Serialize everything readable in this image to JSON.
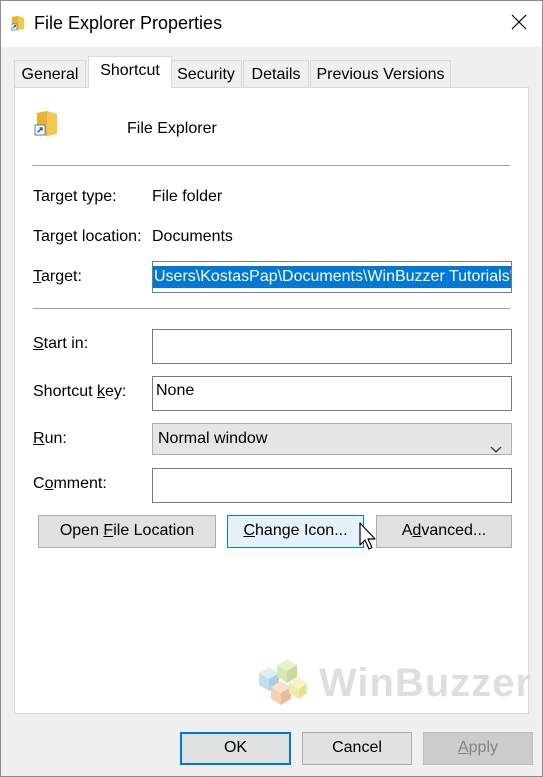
{
  "window": {
    "title": "File Explorer Properties"
  },
  "tabs": [
    "General",
    "Shortcut",
    "Security",
    "Details",
    "Previous Versions"
  ],
  "active_tab": "Shortcut",
  "shortcut": {
    "name": "File Explorer",
    "target_type_label": "Target type:",
    "target_type_value": "File folder",
    "target_location_label": "Target location:",
    "target_location_value": "Documents",
    "target_label_pre": "",
    "target_label_ul": "T",
    "target_label_post": "arget:",
    "target_value": "Users\\KostasPap\\Documents\\WinBuzzer Tutorials\"",
    "start_in_label_pre": "",
    "start_in_label_ul": "S",
    "start_in_label_post": "tart in:",
    "start_in_value": "",
    "shortcut_key_label_pre": "Shortcut ",
    "shortcut_key_label_ul": "k",
    "shortcut_key_label_post": "ey:",
    "shortcut_key_value": "None",
    "run_label_pre": "",
    "run_label_ul": "R",
    "run_label_post": "un:",
    "run_value": "Normal window",
    "comment_label_pre": "C",
    "comment_label_ul": "o",
    "comment_label_post": "mment:",
    "comment_value": ""
  },
  "buttons": {
    "open_file_location_pre": "Open ",
    "open_file_location_ul": "F",
    "open_file_location_post": "ile Location",
    "change_icon_pre": "",
    "change_icon_ul": "C",
    "change_icon_post": "hange Icon...",
    "advanced_pre": "A",
    "advanced_ul": "d",
    "advanced_post": "vanced...",
    "ok": "OK",
    "cancel": "Cancel",
    "apply_pre": "",
    "apply_ul": "A",
    "apply_post": "pply"
  },
  "watermark": {
    "text": "WinBuzzer"
  },
  "colors": {
    "accent": "#0078d7",
    "selection": "#0078d7"
  }
}
